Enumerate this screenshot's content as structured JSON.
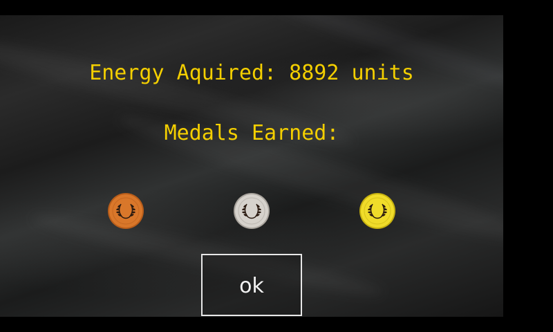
{
  "summary": {
    "energy_text": "Energy Aquired: 8892 units",
    "medals_heading": "Medals Earned:"
  },
  "medals": [
    {
      "name": "bronze",
      "color": "#d9772a",
      "rim": "#b85d1a",
      "icon": "laurel-wreath-icon"
    },
    {
      "name": "silver",
      "color": "#d6d2cc",
      "rim": "#a9a49d",
      "icon": "laurel-wreath-icon"
    },
    {
      "name": "gold",
      "color": "#f0dc2a",
      "rim": "#c7b210",
      "icon": "laurel-wreath-icon"
    }
  ],
  "ok_button": {
    "label": "ok"
  },
  "colors": {
    "heading": "#f4cf00",
    "button_border": "#e8e8e8",
    "button_text": "#f2f2f2",
    "screen_border": "#000000"
  }
}
